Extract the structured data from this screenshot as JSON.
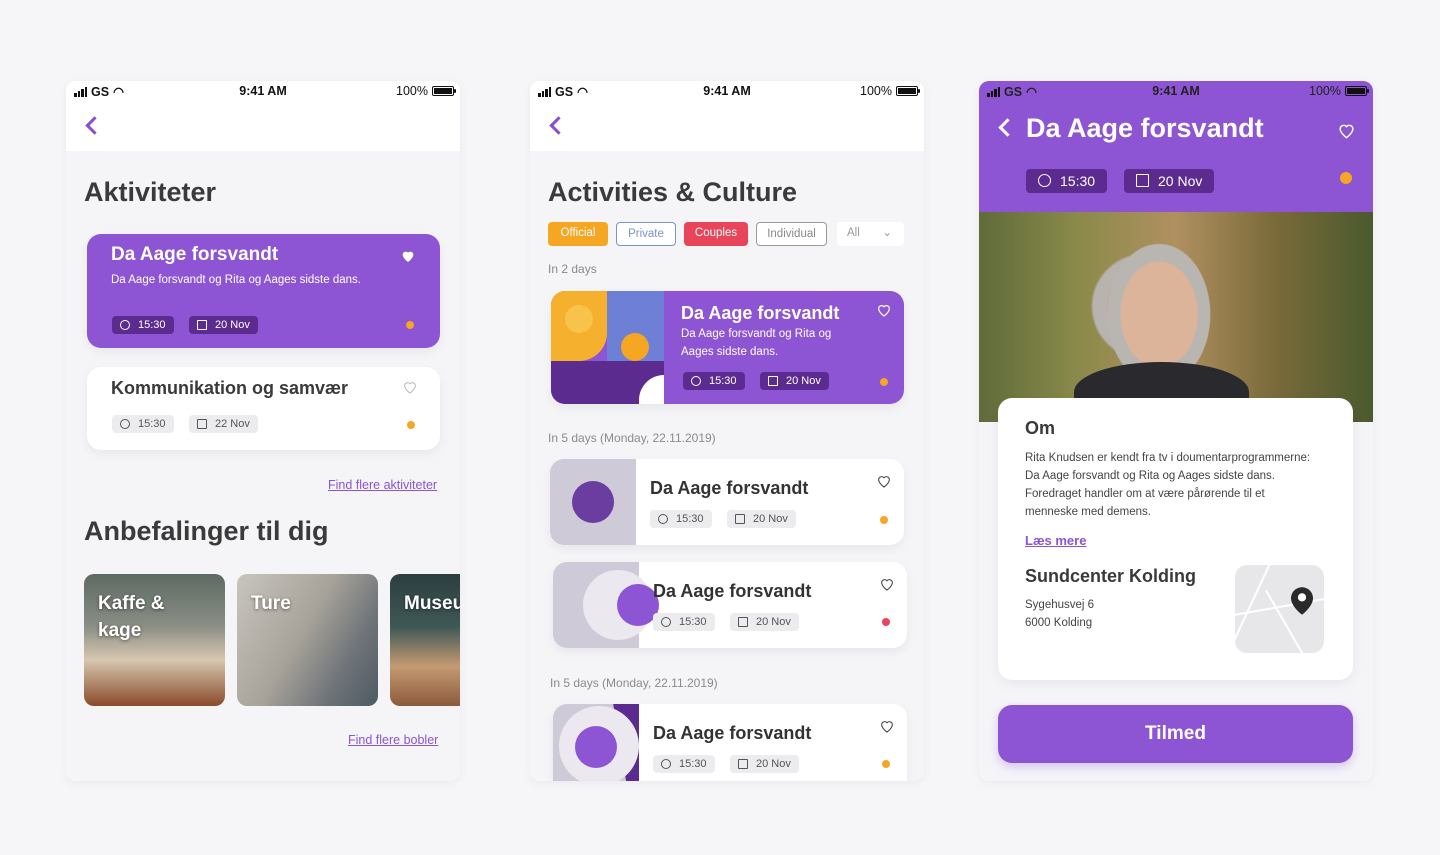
{
  "status": {
    "carrier": "GS",
    "time": "9:41 AM",
    "battery": "100%"
  },
  "screen1": {
    "title": "Aktiviteter",
    "featured": {
      "title": "Da Aage forsvandt",
      "desc": "Da Aage forsvandt og Rita og Aages sidste dans.",
      "time": "15:30",
      "date": "20 Nov"
    },
    "second": {
      "title": "Kommunikation og samvær",
      "time": "15:30",
      "date": "22 Nov"
    },
    "more_link": "Find flere aktiviteter",
    "rec_title": "Anbefalinger til dig",
    "recs": [
      "Kaffe & kage",
      "Ture",
      "Museu"
    ],
    "more_bubbles": "Find flere bobler"
  },
  "screen2": {
    "title": "Activities & Culture",
    "filters": [
      "Official",
      "Private",
      "Couples",
      "Individual"
    ],
    "filter_select": "All",
    "section1": "In 2 days",
    "featured": {
      "title": "Da Aage forsvandt",
      "desc": "Da Aage forsvandt og Rita og Aages sidste dans.",
      "time": "15:30",
      "date": "20 Nov"
    },
    "section2": "In 5 days (Monday, 22.11.2019)",
    "items": [
      {
        "title": "Da Aage forsvandt",
        "time": "15:30",
        "date": "20 Nov"
      },
      {
        "title": "Da Aage forsvandt",
        "time": "15:30",
        "date": "20 Nov"
      },
      {
        "title": "Da Aage forsvandt",
        "time": "15:30",
        "date": "20 Nov"
      }
    ],
    "section3": "In 5 days (Monday, 22.11.2019)"
  },
  "screen3": {
    "title": "Da Aage forsvandt",
    "time": "15:30",
    "date": "20 Nov",
    "about_heading": "Om",
    "about_text": "Rita Knudsen er kendt fra tv i doumentarprogrammerne: Da Aage forsvandt og Rita og Aages sidste dans. Foredraget handler om at være pårørende til et menneske med demens.",
    "read_more": "Læs mere",
    "venue": "Sundcenter Kolding",
    "address1": "Sygehusvej 6",
    "address2": "6000 Kolding",
    "cta": "Tilmed"
  },
  "colors": {
    "purple": "#8d55d3",
    "dark_purple": "#5b2b8f",
    "orange": "#f5a623",
    "red": "#e8445a",
    "official": "#f5a623",
    "couples": "#e8445a"
  }
}
